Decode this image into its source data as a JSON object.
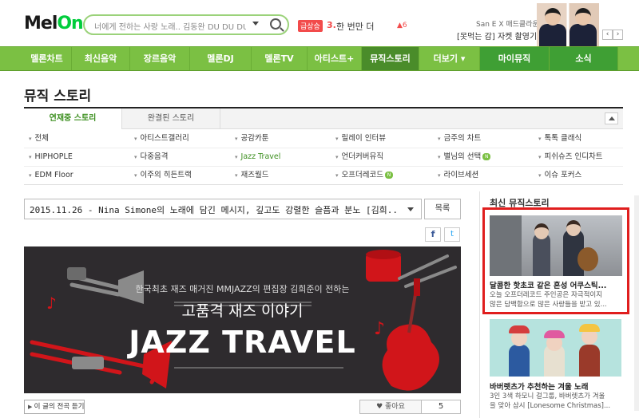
{
  "header": {
    "logo_main": "Mel",
    "logo_accent": "On",
    "search_placeholder": "너에게 전하는 사랑 노래.. 김동완 DU DU DU",
    "rank_badge": "급상승",
    "rank_number": "3.",
    "rank_title": "한 번만 더",
    "rank_arrow": "▲6",
    "ad_line1": "San E X 매드클라운",
    "ad_line2": "[못먹는 감] 자켓 촬영기",
    "ad_prev": "‹",
    "ad_next": "›"
  },
  "nav": {
    "items": [
      {
        "label": "멜론차트"
      },
      {
        "label": "최신음악"
      },
      {
        "label": "장르음악"
      },
      {
        "label": "멜론DJ"
      },
      {
        "label": "멜론TV"
      },
      {
        "label": "아티스트+"
      },
      {
        "label": "뮤직스토리"
      },
      {
        "label": "더보기 ▾"
      },
      {
        "label": "마이뮤직"
      },
      {
        "label": "소식"
      }
    ]
  },
  "page": {
    "title": "뮤직 스토리",
    "tabs": [
      {
        "label": "연재중 스토리"
      },
      {
        "label": "완결된 스토리"
      }
    ]
  },
  "categories": [
    [
      "전체",
      "아티스트갤러리",
      "공감카툰",
      "릴레이 인터뷰",
      "금주의 차트",
      "톡톡 클래식"
    ],
    [
      "HIPHOPLE",
      "다중음격",
      "Jazz Travel",
      "언더커버뮤직",
      "별님의 선택",
      "피쉬슈즈 인디차트"
    ],
    [
      "EDM Floor",
      "이주의 히든트랙",
      "재즈월드",
      "오프더레코드",
      "라이브세션",
      "이슈 포커스"
    ]
  ],
  "category_badge": "N",
  "article": {
    "selected": "2015.11.26 - Nina Simone의 노래에 담긴 메시지, 깊고도 강렬한 슬픔과 분노 [김희...",
    "list_button": "목록",
    "facebook": "f",
    "twitter": "t",
    "banner_sub": "한국최초 재즈 매거진 MMJAZZ의 편집장 김희준이 전하는",
    "banner_title": "고품격 재즈 이야기",
    "banner_main": "JAZZ TRAVEL",
    "listen_button": "이 글의 전곡 듣기",
    "like_label": "♥ 좋아요",
    "like_count": "5"
  },
  "sidebar": {
    "title": "최신 뮤직스토리",
    "stories": [
      {
        "title": "달콤한 핫초코 같은 혼성 어쿠스틱...",
        "desc1": "오늘 오프더레코드 주인공은 자극적이지",
        "desc2": "않은 담백함으로 많은 사랑들을 받고 있..."
      },
      {
        "title": "바버렛츠가 추천하는 겨울 노래",
        "desc1": "3인 3색 하모니 걸그룹, 바버렛츠가 겨울",
        "desc2": "을 맞아 삼시 [Lonesome Christmas]..."
      }
    ]
  },
  "colors": {
    "brand_green": "#7bc043",
    "active_nav": "#4a8c2a",
    "highlight_border": "#e01e1e",
    "banner_red": "#d1151a"
  }
}
